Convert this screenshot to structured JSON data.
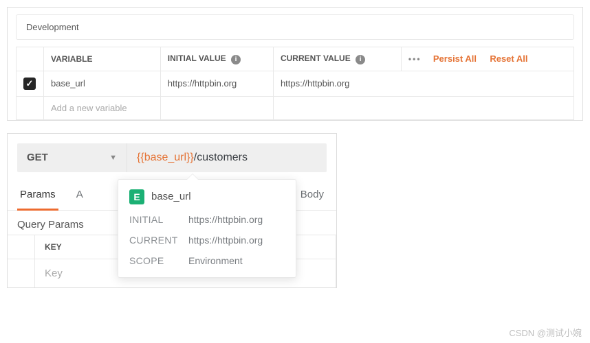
{
  "env": {
    "title": "Development",
    "headers": {
      "variable": "VARIABLE",
      "initial": "INITIAL VALUE",
      "current": "CURRENT VALUE"
    },
    "actions": {
      "more": "•••",
      "persist": "Persist All",
      "reset": "Reset All"
    },
    "rows": [
      {
        "checked": true,
        "variable": "base_url",
        "initial": "https://httpbin.org",
        "current": "https://httpbin.org"
      }
    ],
    "add_placeholder": "Add a new variable"
  },
  "req": {
    "method": "GET",
    "url_var": "{{base_url}}",
    "url_rest": "/customers",
    "tabs": {
      "params": "Params",
      "auth_partial": "A",
      "body": "Body"
    },
    "sub_heading": "Query Params",
    "kv": {
      "key_header": "KEY",
      "key_placeholder": "Key"
    }
  },
  "popover": {
    "badge": "E",
    "var_name": "base_url",
    "rows": {
      "initial_lbl": "INITIAL",
      "initial_val": "https://httpbin.org",
      "current_lbl": "CURRENT",
      "current_val": "https://httpbin.org",
      "scope_lbl": "SCOPE",
      "scope_val": "Environment"
    }
  },
  "watermark": "CSDN @测试小婉"
}
